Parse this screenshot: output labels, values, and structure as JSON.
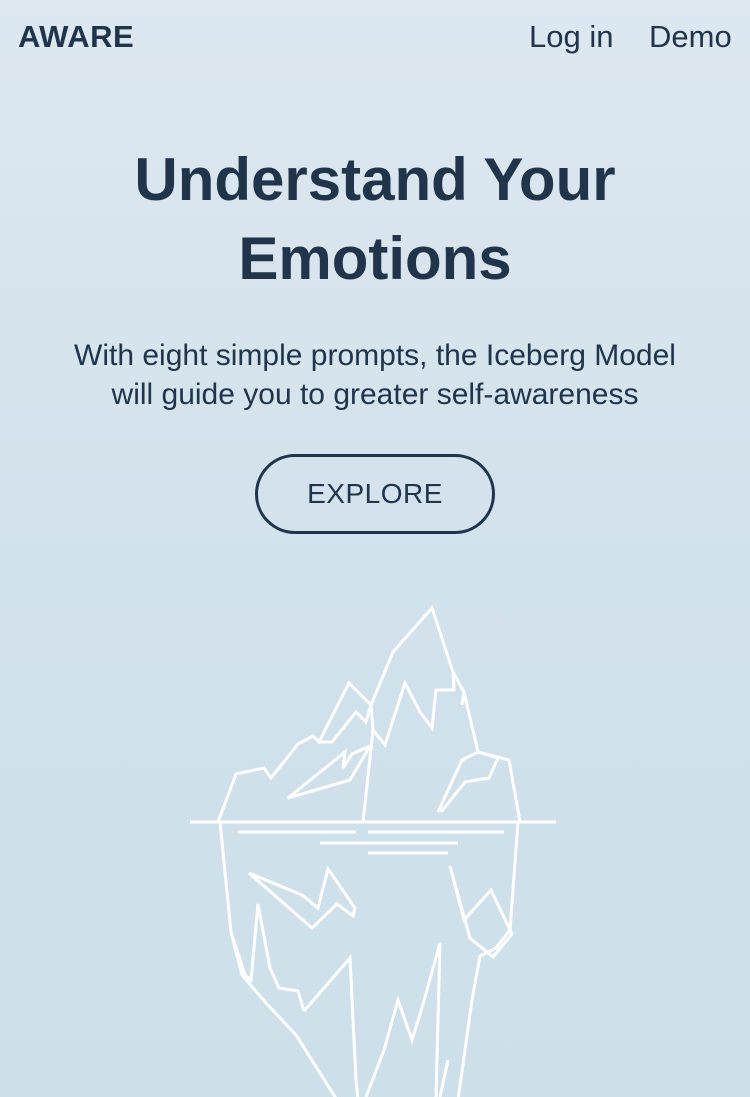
{
  "header": {
    "brand": "AWARE",
    "nav": {
      "login_label": "Log in",
      "demo_label": "Demo"
    }
  },
  "hero": {
    "title_line1": "Understand Your",
    "title_line2": "Emotions",
    "subtitle_line1": "With eight simple prompts, the Iceberg Model",
    "subtitle_line2": "will guide you to greater self-awareness",
    "cta_label": "EXPLORE"
  },
  "colors": {
    "text": "#22344a",
    "background_top": "#dde8f1",
    "background_bottom": "#cddfe9",
    "illustration_stroke": "#ffffff"
  },
  "icons": {
    "illustration": "iceberg-icon"
  }
}
